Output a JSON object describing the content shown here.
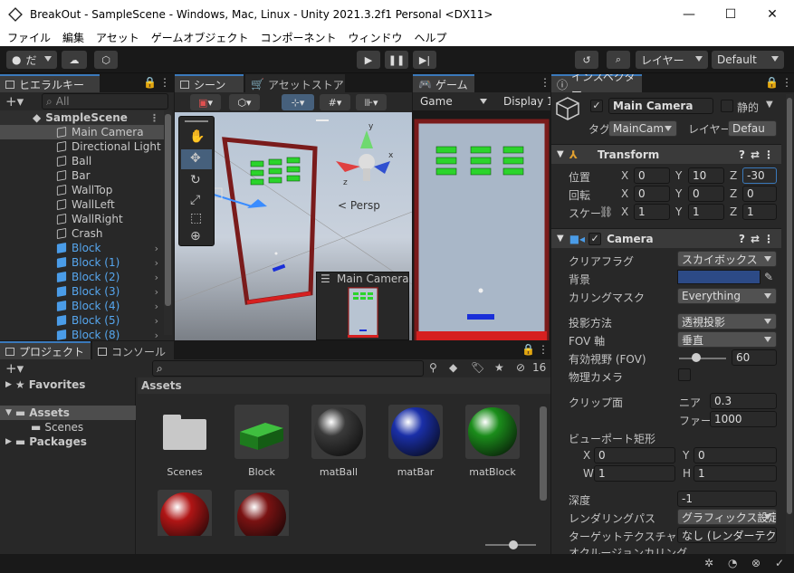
{
  "window": {
    "title": "BreakOut - SampleScene - Windows, Mac, Linux - Unity 2021.3.2f1 Personal <DX11>"
  },
  "menu": [
    "ファイル",
    "編集",
    "アセット",
    "ゲームオブジェクト",
    "コンポーネント",
    "ウィンドウ",
    "ヘルプ"
  ],
  "toolbar": {
    "account": "だ",
    "layers": "レイヤー",
    "layout": "Default"
  },
  "hierarchy": {
    "tab": "ヒエラルキー",
    "search_placeholder": "All",
    "scene": "SampleScene",
    "items": [
      {
        "name": "Main Camera",
        "type": "normal",
        "selected": true
      },
      {
        "name": "Directional Light",
        "type": "normal"
      },
      {
        "name": "Ball",
        "type": "normal"
      },
      {
        "name": "Bar",
        "type": "normal"
      },
      {
        "name": "WallTop",
        "type": "normal"
      },
      {
        "name": "WallLeft",
        "type": "normal"
      },
      {
        "name": "WallRight",
        "type": "normal"
      },
      {
        "name": "Crash",
        "type": "normal"
      },
      {
        "name": "Block",
        "type": "prefab"
      },
      {
        "name": "Block (1)",
        "type": "prefab"
      },
      {
        "name": "Block (2)",
        "type": "prefab"
      },
      {
        "name": "Block (3)",
        "type": "prefab"
      },
      {
        "name": "Block (4)",
        "type": "prefab"
      },
      {
        "name": "Block (5)",
        "type": "prefab"
      },
      {
        "name": "Block (8)",
        "type": "prefab"
      }
    ]
  },
  "scene": {
    "tab_scene": "シーン",
    "tab_store": "アセットストア",
    "persp": "< Persp",
    "preview_title": "Main Camera"
  },
  "game": {
    "tab": "ゲーム",
    "display_mode": "Game",
    "display": "Display 1"
  },
  "inspector": {
    "tab": "インスペクター",
    "object_name": "Main Camera",
    "static_label": "静的",
    "tag_label": "タグ",
    "tag_value": "MainCam",
    "layer_label": "レイヤー",
    "layer_value": "Defau",
    "transform": {
      "title": "Transform",
      "position_label": "位置",
      "position": {
        "x": "0",
        "y": "10",
        "z": "-30"
      },
      "rotation_label": "回転",
      "rotation": {
        "x": "0",
        "y": "0",
        "z": "0"
      },
      "scale_label": "スケー",
      "scale": {
        "x": "1",
        "y": "1",
        "z": "1"
      }
    },
    "camera": {
      "title": "Camera",
      "clear_flags_label": "クリアフラグ",
      "clear_flags": "スカイボックス",
      "background_label": "背景",
      "background_color": "#2c4a86",
      "culling_mask_label": "カリングマスク",
      "culling_mask": "Everything",
      "projection_label": "投影方法",
      "projection": "透視投影",
      "fov_axis_label": "FOV 軸",
      "fov_axis": "垂直",
      "fov_label": "有効視野 (FOV)",
      "fov": "60",
      "physical_label": "物理カメラ",
      "clip_label": "クリップ面",
      "near_label": "ニア",
      "near": "0.3",
      "far_label": "ファー",
      "far": "1000",
      "viewport_label": "ビューポート矩形",
      "vx": "0",
      "vy": "0",
      "vw": "1",
      "vh": "1",
      "depth_label": "深度",
      "depth": "-1",
      "rendering_path_label": "レンダリングパス",
      "rendering_path": "グラフィックス設定を",
      "target_texture_label": "ターゲットテクスチャ",
      "target_texture": "なし (レンダーテクス",
      "occlusion_label": "オクルージョンカリング"
    }
  },
  "project": {
    "tab_project": "プロジェクト",
    "tab_console": "コンソール",
    "count": "16",
    "tree": {
      "favorites": "Favorites",
      "assets": "Assets",
      "scenes": "Scenes",
      "packages": "Packages"
    },
    "header": "Assets",
    "assets": [
      {
        "name": "Scenes",
        "kind": "folder"
      },
      {
        "name": "Block",
        "kind": "block"
      },
      {
        "name": "matBall",
        "kind": "sphere",
        "color": "#3a3a3a"
      },
      {
        "name": "matBar",
        "kind": "sphere",
        "color": "#1a2fa8"
      },
      {
        "name": "matBlock",
        "kind": "sphere",
        "color": "#1b8d1b"
      },
      {
        "name": "",
        "kind": "sphere",
        "color": "#b01515"
      },
      {
        "name": "",
        "kind": "sphere",
        "color": "#7a1212"
      }
    ]
  }
}
